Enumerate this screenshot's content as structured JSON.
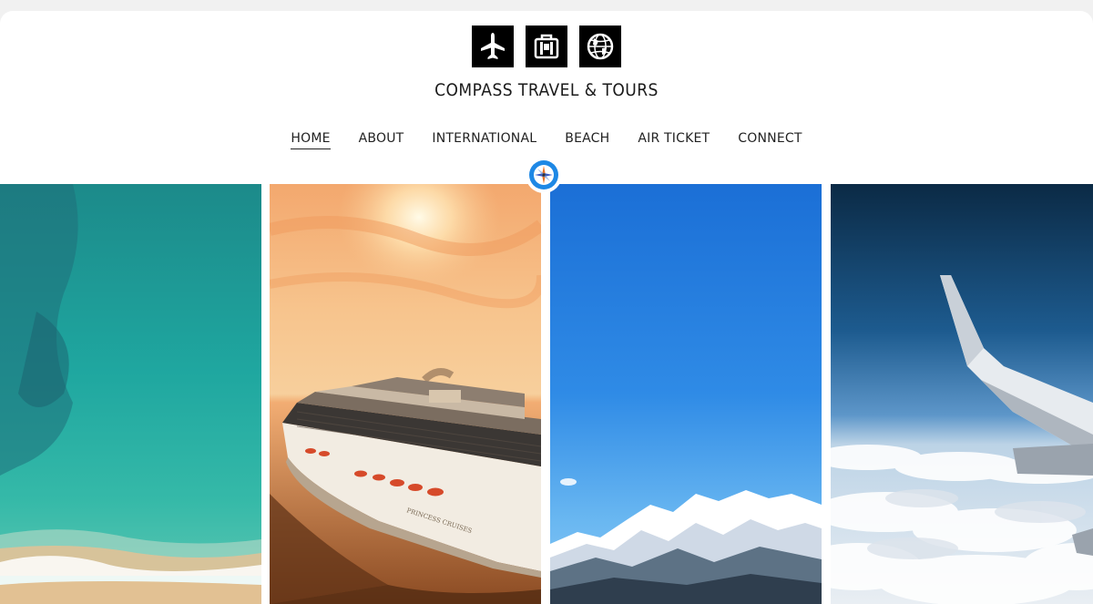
{
  "brand": {
    "name": "COMPASS TRAVEL & TOURS"
  },
  "icons": {
    "logo": [
      "airplane-icon",
      "suitcase-icon",
      "globe-icon"
    ],
    "badge": "compass-icon"
  },
  "nav": {
    "items": [
      {
        "label": "HOME",
        "active": true
      },
      {
        "label": "ABOUT"
      },
      {
        "label": "INTERNATIONAL"
      },
      {
        "label": "BEACH"
      },
      {
        "label": "AIR TICKET"
      },
      {
        "label": "CONNECT"
      }
    ]
  },
  "panels": [
    {
      "subject": "aerial-ocean-beach"
    },
    {
      "subject": "cruise-ship-sunset",
      "ship_text": "PRINCESS CRUISES"
    },
    {
      "subject": "snowy-mountains-sky"
    },
    {
      "subject": "airplane-wing-clouds"
    }
  ],
  "colors": {
    "accent": "#1e88e5",
    "logo_bg": "#000000",
    "text": "#222222"
  }
}
